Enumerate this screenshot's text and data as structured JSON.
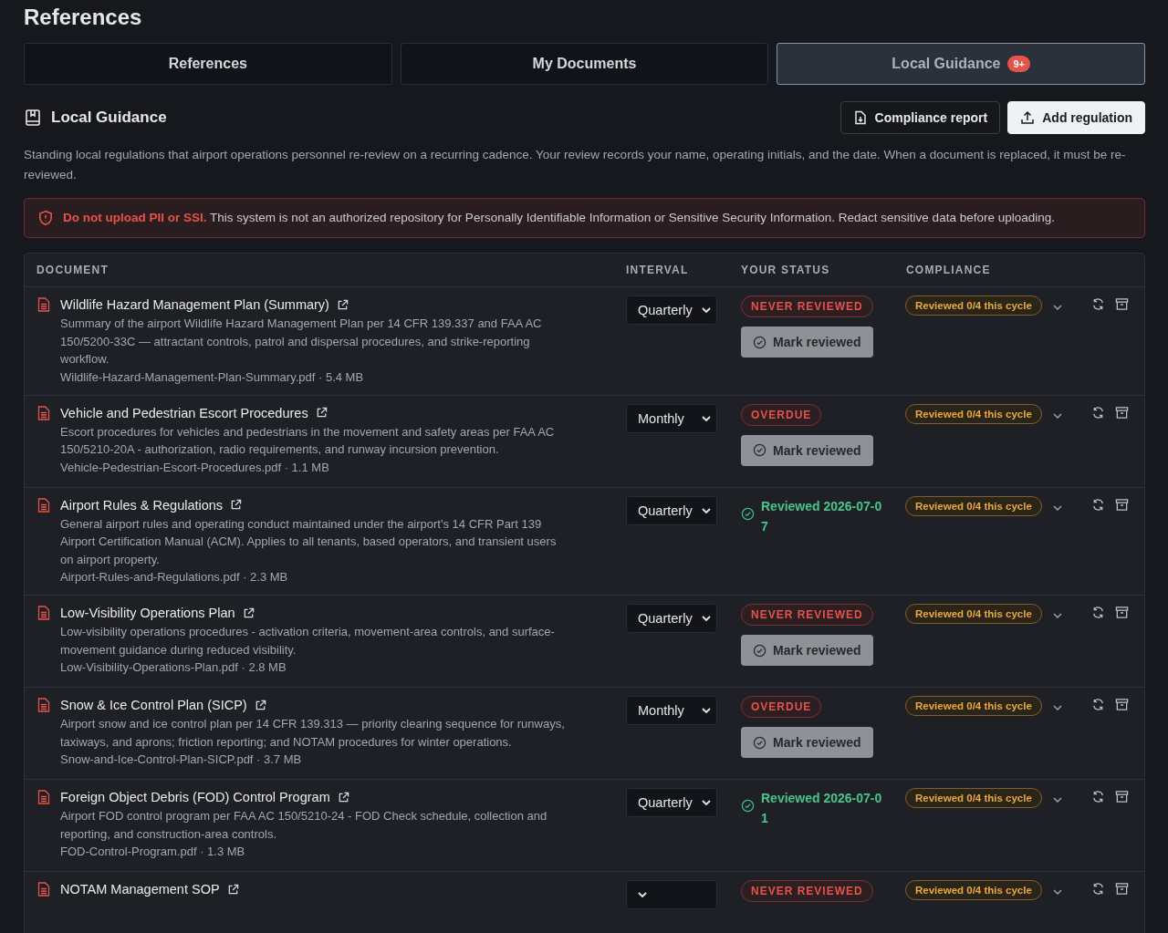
{
  "page_title": "References",
  "tabs": [
    {
      "label": "References",
      "selected": false
    },
    {
      "label": "My Documents",
      "selected": false
    },
    {
      "label": "Local Guidance",
      "selected": true,
      "badge": "9+"
    }
  ],
  "section": {
    "title": "Local Guidance",
    "buttons": [
      {
        "label": "Compliance report",
        "kind": "secondary"
      },
      {
        "label": "Add regulation",
        "kind": "primary"
      }
    ],
    "description": "Standing local regulations that airport operations personnel re-review on a recurring cadence. Your review records your name, operating initials, and the date. When a document is replaced, it must be re-reviewed."
  },
  "alert": {
    "text": "**Do not upload PII or SSI.** This system is not an authorized repository for Personally Identifiable Information or Sensitive Security Information. Redact sensitive data before uploading."
  },
  "table": {
    "columns": [
      "DOCUMENT",
      "INTERVAL",
      "YOUR STATUS",
      "COMPLIANCE"
    ],
    "rows": [
      {
        "title": "Wildlife Hazard Management Plan (Summary)",
        "description": "Summary of the airport Wildlife Hazard Management Plan per 14 CFR 139.337 and FAA AC 150/5200-33C — attractant controls, patrol and dispersal procedures, and strike-reporting workflow.",
        "file": "Wildlife-Hazard-Management-Plan-Summary.pdf · 5.4 MB",
        "interval": "Quarterly",
        "status": {
          "kind": "never",
          "text": "NEVER REVIEWED"
        },
        "action": "Mark reviewed",
        "compliance": "Reviewed 0/4 this cycle"
      },
      {
        "title": "Vehicle and Pedestrian Escort Procedures",
        "description": "Escort procedures for vehicles and pedestrians in the movement and safety areas per FAA AC 150/5210-20A - authorization, radio requirements, and runway incursion prevention.",
        "file": "Vehicle-Pedestrian-Escort-Procedures.pdf · 1.1 MB",
        "interval": "Monthly",
        "status": {
          "kind": "overdue",
          "text": "OVERDUE"
        },
        "action": "Mark reviewed",
        "compliance": "Reviewed 0/4 this cycle"
      },
      {
        "title": "Airport Rules & Regulations",
        "description": "General airport rules and operating conduct maintained under the airport's 14 CFR Part 139 Airport Certification Manual (ACM). Applies to all tenants, based operators, and transient users on airport property.",
        "file": "Airport-Rules-and-Regulations.pdf · 2.3 MB",
        "interval": "Quarterly",
        "status": {
          "kind": "reviewed",
          "text": "Reviewed 2026-07-07"
        },
        "compliance": "Reviewed 0/4 this cycle"
      },
      {
        "title": "Low-Visibility Operations Plan",
        "description": "Low-visibility operations procedures - activation criteria, movement-area controls, and surface-movement guidance during reduced visibility.",
        "file": "Low-Visibility-Operations-Plan.pdf · 2.8 MB",
        "interval": "Quarterly",
        "status": {
          "kind": "never",
          "text": "NEVER REVIEWED"
        },
        "action": "Mark reviewed",
        "compliance": "Reviewed 0/4 this cycle"
      },
      {
        "title": "Snow & Ice Control Plan (SICP)",
        "description": "Airport snow and ice control plan per 14 CFR 139.313 — priority clearing sequence for runways, taxiways, and aprons; friction reporting; and NOTAM procedures for winter operations.",
        "file": "Snow-and-Ice-Control-Plan-SICP.pdf · 3.7 MB",
        "interval": "Monthly",
        "status": {
          "kind": "overdue",
          "text": "OVERDUE"
        },
        "action": "Mark reviewed",
        "compliance": "Reviewed 0/4 this cycle"
      },
      {
        "title": "Foreign Object Debris (FOD) Control Program",
        "description": "Airport FOD control program per FAA AC 150/5210-24 - FOD Check schedule, collection and reporting, and construction-area controls.",
        "file": "FOD-Control-Program.pdf · 1.3 MB",
        "interval": "Quarterly",
        "status": {
          "kind": "reviewed",
          "text": "Reviewed 2026-07-01"
        },
        "compliance": "Reviewed 0/4 this cycle"
      },
      {
        "title": "NOTAM Management SOP",
        "status": {
          "kind": "never",
          "text": "NEVER REVIEWED"
        },
        "compliance": "Reviewed 0/4 this cycle"
      }
    ]
  }
}
